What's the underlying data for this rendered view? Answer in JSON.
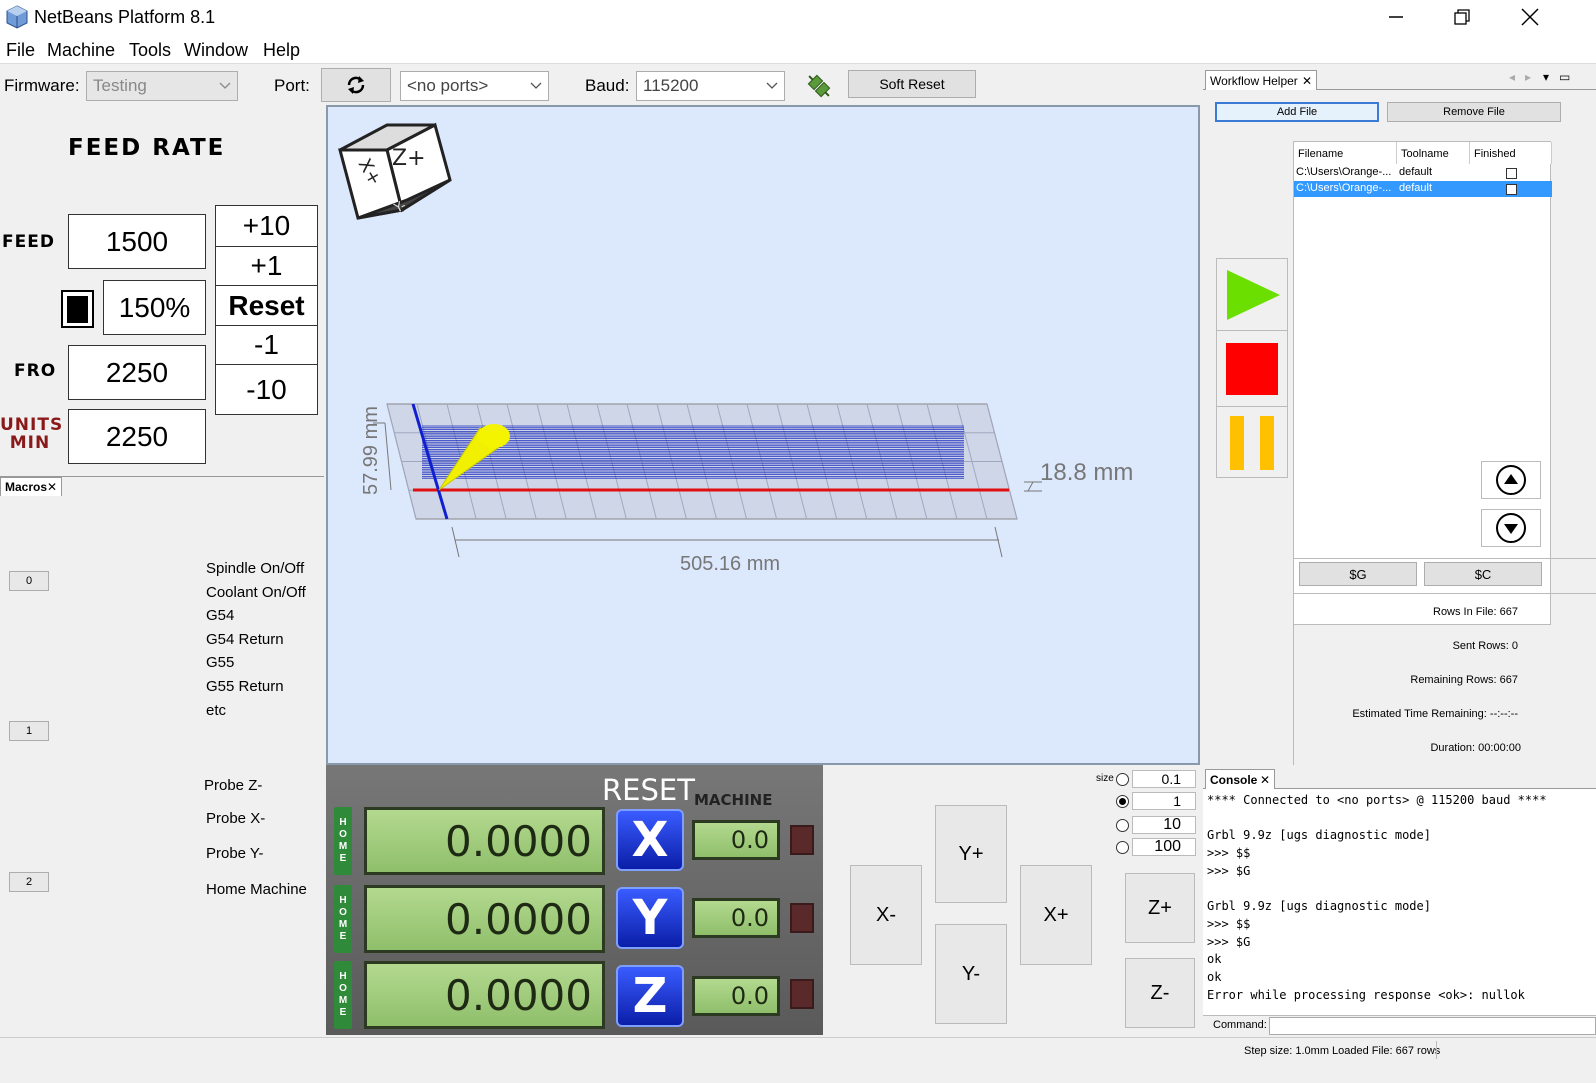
{
  "app": {
    "title": "NetBeans Platform 8.1"
  },
  "menu": [
    "File",
    "Machine",
    "Tools",
    "Window",
    "Help"
  ],
  "toolbar": {
    "firmware_label": "Firmware:",
    "firmware_value": "Testing",
    "port_label": "Port:",
    "port_value": "<no ports>",
    "baud_label": "Baud:",
    "baud_value": "115200",
    "soft_reset": "Soft Reset"
  },
  "feed": {
    "title": "FEED RATE",
    "feed_label": "FEED",
    "feed_value": "1500",
    "percent": "150%",
    "fro_label": "FRO",
    "fro_value": "2250",
    "units_label1": "UNITS",
    "units_label2": "MIN",
    "units_value": "2250",
    "steps": [
      "+10",
      "+1",
      "Reset",
      "-1",
      "-10"
    ]
  },
  "macros": {
    "tab": "Macros",
    "buttons": [
      "0",
      "1",
      "2"
    ],
    "group0": [
      "Spindle On/Off",
      "Coolant On/Off",
      "G54",
      "G54 Return",
      "G55",
      "G55 Return",
      "etc"
    ],
    "group2": [
      "Probe Z-",
      "Probe X-",
      "Probe Y-",
      "Home Machine"
    ]
  },
  "viewport": {
    "cube_top": "Z+",
    "cube_left": "X+",
    "cube_bottom": "Y-",
    "dim_x": "505.16 mm",
    "dim_y": "57.99 mm",
    "dim_z": "18.8 mm"
  },
  "dro": {
    "reset": "RESET",
    "machine": "MACHINE",
    "home": [
      "H",
      "O",
      "M",
      "E"
    ],
    "axes": [
      {
        "name": "X",
        "work": "0.0000",
        "machine": "0.0"
      },
      {
        "name": "Y",
        "work": "0.0000",
        "machine": "0.0"
      },
      {
        "name": "Z",
        "work": "0.0000",
        "machine": "0.0"
      }
    ]
  },
  "jog": {
    "size_label": "size",
    "steps": [
      "0.1",
      "1",
      "10",
      "100"
    ],
    "selected_step": "1",
    "xminus": "X-",
    "xplus": "X+",
    "yplus": "Y+",
    "yminus": "Y-",
    "zplus": "Z+",
    "zminus": "Z-"
  },
  "workflow": {
    "tab": "Workflow Helper",
    "add_file": "Add File",
    "remove_file": "Remove File",
    "columns": [
      "Filename",
      "Toolname",
      "Finished"
    ],
    "rows": [
      {
        "file": "C:\\Users\\Orange-...",
        "tool": "default",
        "finished": false
      },
      {
        "file": "C:\\Users\\Orange-...",
        "tool": "default",
        "finished": false
      }
    ],
    "g_button": "$G",
    "c_button": "$C",
    "stats": [
      {
        "label": "Rows In File:",
        "value": "667"
      },
      {
        "label": "Sent Rows:",
        "value": "0"
      },
      {
        "label": "Remaining Rows:",
        "value": "667"
      },
      {
        "label": "Estimated Time Remaining:",
        "value": "--:--:--"
      },
      {
        "label": "Duration:",
        "value": "00:00:00"
      }
    ],
    "colors": {
      "play": "#6be000",
      "stop": "#ff0000",
      "pause": "#ffc000"
    }
  },
  "console": {
    "tab": "Console",
    "lines": [
      "**** Connected to <no ports> @ 115200 baud ****",
      "",
      "Grbl 9.9z [ugs diagnostic mode]",
      ">>> $$",
      ">>> $G",
      "",
      "Grbl 9.9z [ugs diagnostic mode]",
      ">>> $$",
      ">>> $G",
      "ok",
      "ok",
      "Error while processing response <ok>: nullok"
    ],
    "command_label": "Command:"
  },
  "status": {
    "text": "Step size: 1.0mm Loaded File: 667 rows"
  }
}
